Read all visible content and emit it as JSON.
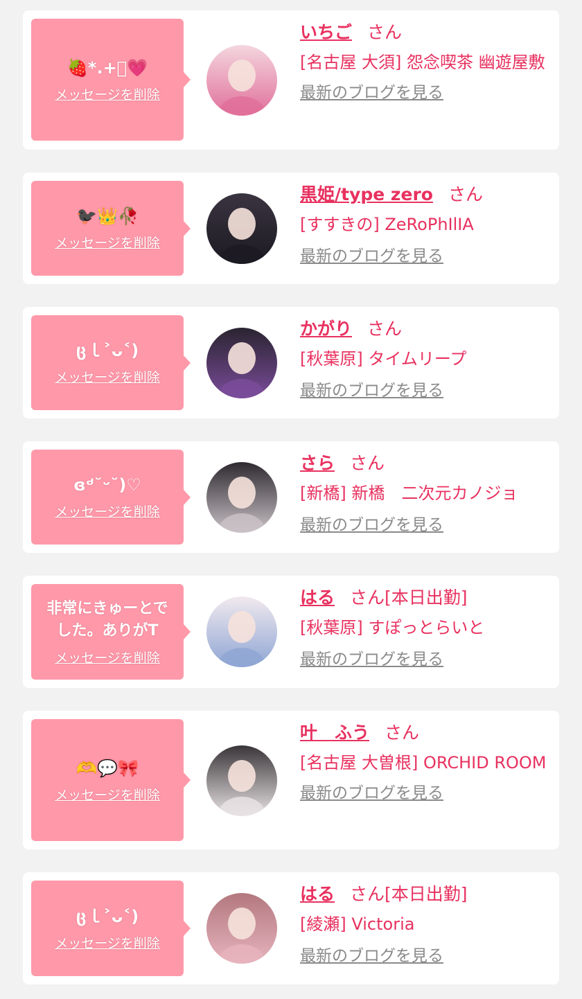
{
  "items": [
    {
      "message": "🍓*.+ﾟ💗",
      "delete_label": "メッセージを削除",
      "name": "いちご",
      "suffix": "さん",
      "shop": "[名古屋 大須] 怨念喫茶 幽遊屋敷",
      "blog_label": "最新のブログを見る",
      "avatar_colors": [
        "#f4d6de",
        "#e0709a"
      ]
    },
    {
      "message": "🐦‍⬛👑🥀",
      "delete_label": "メッセージを削除",
      "name": "黒姫/type zero",
      "suffix": "さん",
      "shop": "[すすきの] ZeRoPhIlIA",
      "blog_label": "最新のブログを見る",
      "avatar_colors": [
        "#3a3440",
        "#1c1a22"
      ]
    },
    {
      "message": "ცｌ˃ᴗ˂)",
      "delete_label": "メッセージを削除",
      "name": "かがり",
      "suffix": "さん",
      "shop": "[秋葉原] タイムリープ",
      "blog_label": "最新のブログを見る",
      "avatar_colors": [
        "#2a2430",
        "#7a4c9a"
      ]
    },
    {
      "message": "ɞᒄ˘ᵕ˘)♡",
      "delete_label": "メッセージを削除",
      "name": "さら",
      "suffix": "さん",
      "shop": "[新橋] 新橋　二次元カノジョ",
      "blog_label": "最新のブログを見る",
      "avatar_colors": [
        "#2e2a30",
        "#c9c1c6"
      ]
    },
    {
      "message": "非常にきゅーとでした。ありがT",
      "delete_label": "メッセージを削除",
      "name": "はる",
      "suffix": "さん[本日出勤]",
      "shop": "[秋葉原] すぽっとらいと",
      "blog_label": "最新のブログを見る",
      "avatar_colors": [
        "#f1e9ee",
        "#8fa6d4"
      ]
    },
    {
      "message": "🫶💬🎀",
      "delete_label": "メッセージを削除",
      "name": "叶　ふう",
      "suffix": "さん",
      "shop": "[名古屋 大曽根] ORCHID ROOM",
      "blog_label": "最新のブログを見る",
      "avatar_colors": [
        "#3a3538",
        "#e8e2e4"
      ]
    },
    {
      "message": "ცｌ˃ᴗ˂)",
      "delete_label": "メッセージを削除",
      "name": "はる",
      "suffix": "さん[本日出勤]",
      "shop": "[綾瀬] Victoria",
      "blog_label": "最新のブログを見る",
      "avatar_colors": [
        "#b3787f",
        "#e6b3bd"
      ]
    }
  ]
}
